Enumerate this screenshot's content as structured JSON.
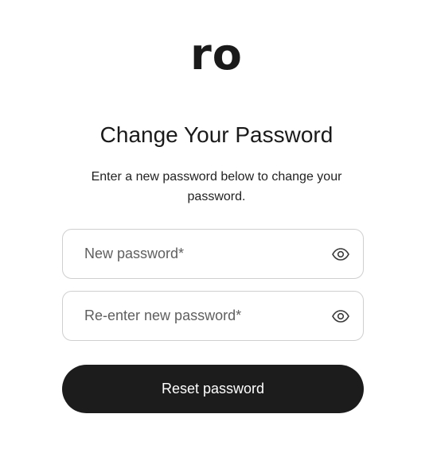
{
  "brand": {
    "logo_text": "ro"
  },
  "page": {
    "title": "Change Your Password",
    "subtitle": "Enter a new password below to change your password."
  },
  "form": {
    "new_password": {
      "placeholder": "New password*",
      "value": "",
      "icon": "eye-icon"
    },
    "confirm_password": {
      "placeholder": "Re-enter new password*",
      "value": "",
      "icon": "eye-icon"
    },
    "submit_label": "Reset password"
  },
  "colors": {
    "background": "#ffffff",
    "text": "#1a1a1a",
    "field_border": "#cfcfcf",
    "placeholder": "#5f5f5f",
    "button_bg": "#1c1c1c",
    "button_text": "#ffffff"
  }
}
